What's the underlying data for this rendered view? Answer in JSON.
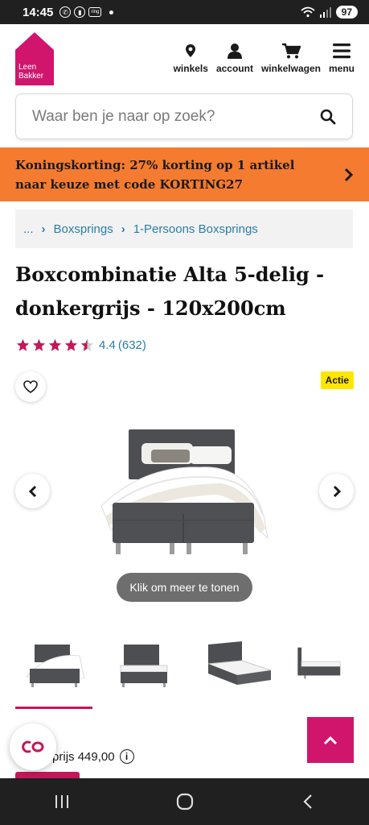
{
  "status_bar": {
    "time": "14:45",
    "battery": "97",
    "ring_label": "ring"
  },
  "header": {
    "logo_text": [
      "Leen",
      "Bakker"
    ],
    "nav": [
      {
        "label": "winkels",
        "icon": "location-pin-icon"
      },
      {
        "label": "account",
        "icon": "user-icon"
      },
      {
        "label": "winkelwagen",
        "icon": "cart-icon"
      },
      {
        "label": "menu",
        "icon": "hamburger-menu-icon"
      }
    ]
  },
  "search": {
    "placeholder": "Waar ben je naar op zoek?",
    "value": ""
  },
  "promo": {
    "line1": "Koningskorting: 27% korting op 1 artikel",
    "line2": "naar keuze met code KORTING27"
  },
  "breadcrumb": {
    "items": [
      "...",
      "Boxsprings",
      "1-Persoons Boxsprings"
    ]
  },
  "product": {
    "title_line1": "Boxcombinatie Alta 5-delig -",
    "title_line2": "donkergrijs - 120x200cm",
    "rating": 4.4,
    "rating_text": "4.4",
    "review_count": "(632)",
    "badge": "Actie",
    "more_label": "Klik om meer te tonen",
    "thumbnail_count": 4,
    "price_text": "prijs 449,00",
    "price_prefix": "ale"
  },
  "colors": {
    "brand_pink": "#d1156d",
    "promo_orange": "#f47b30",
    "link_blue": "#2a7fa7",
    "badge_yellow": "#ffe600"
  }
}
